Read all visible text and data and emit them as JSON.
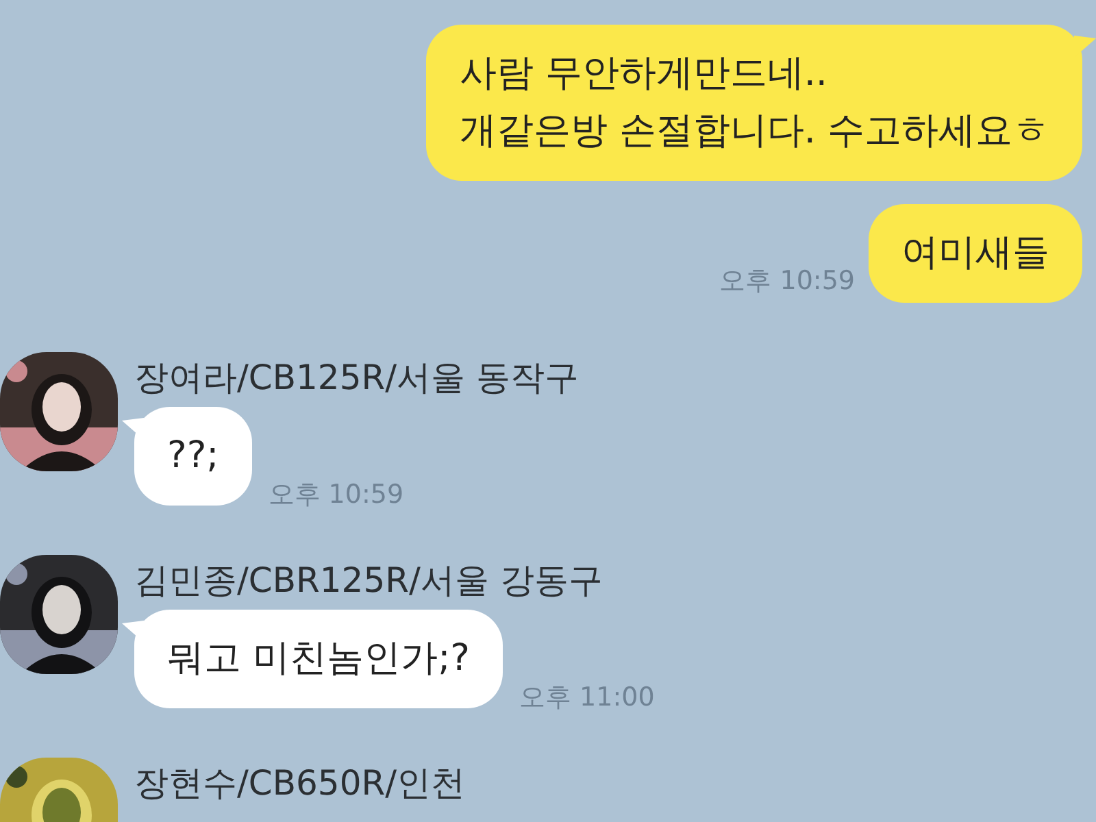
{
  "messages": [
    {
      "kind": "sent",
      "text": "사람 무안하게만드네..\n개같은방 손절합니다. 수고하세요ㅎ",
      "tail": true
    },
    {
      "kind": "sent",
      "text": "여미새들",
      "time": "오후 10:59",
      "tail": false
    },
    {
      "kind": "received",
      "sender": "장여라/CB125R/서울 동작구",
      "text": "??;",
      "time": "오후 10:59",
      "tail": true
    },
    {
      "kind": "received",
      "sender": "김민종/CBR125R/서울 강동구",
      "text": "뭐고 미친놈인가;?",
      "time": "오후 11:00",
      "tail": true
    },
    {
      "kind": "received",
      "sender": "장현수/CB650R/인천",
      "tail": false
    }
  ]
}
